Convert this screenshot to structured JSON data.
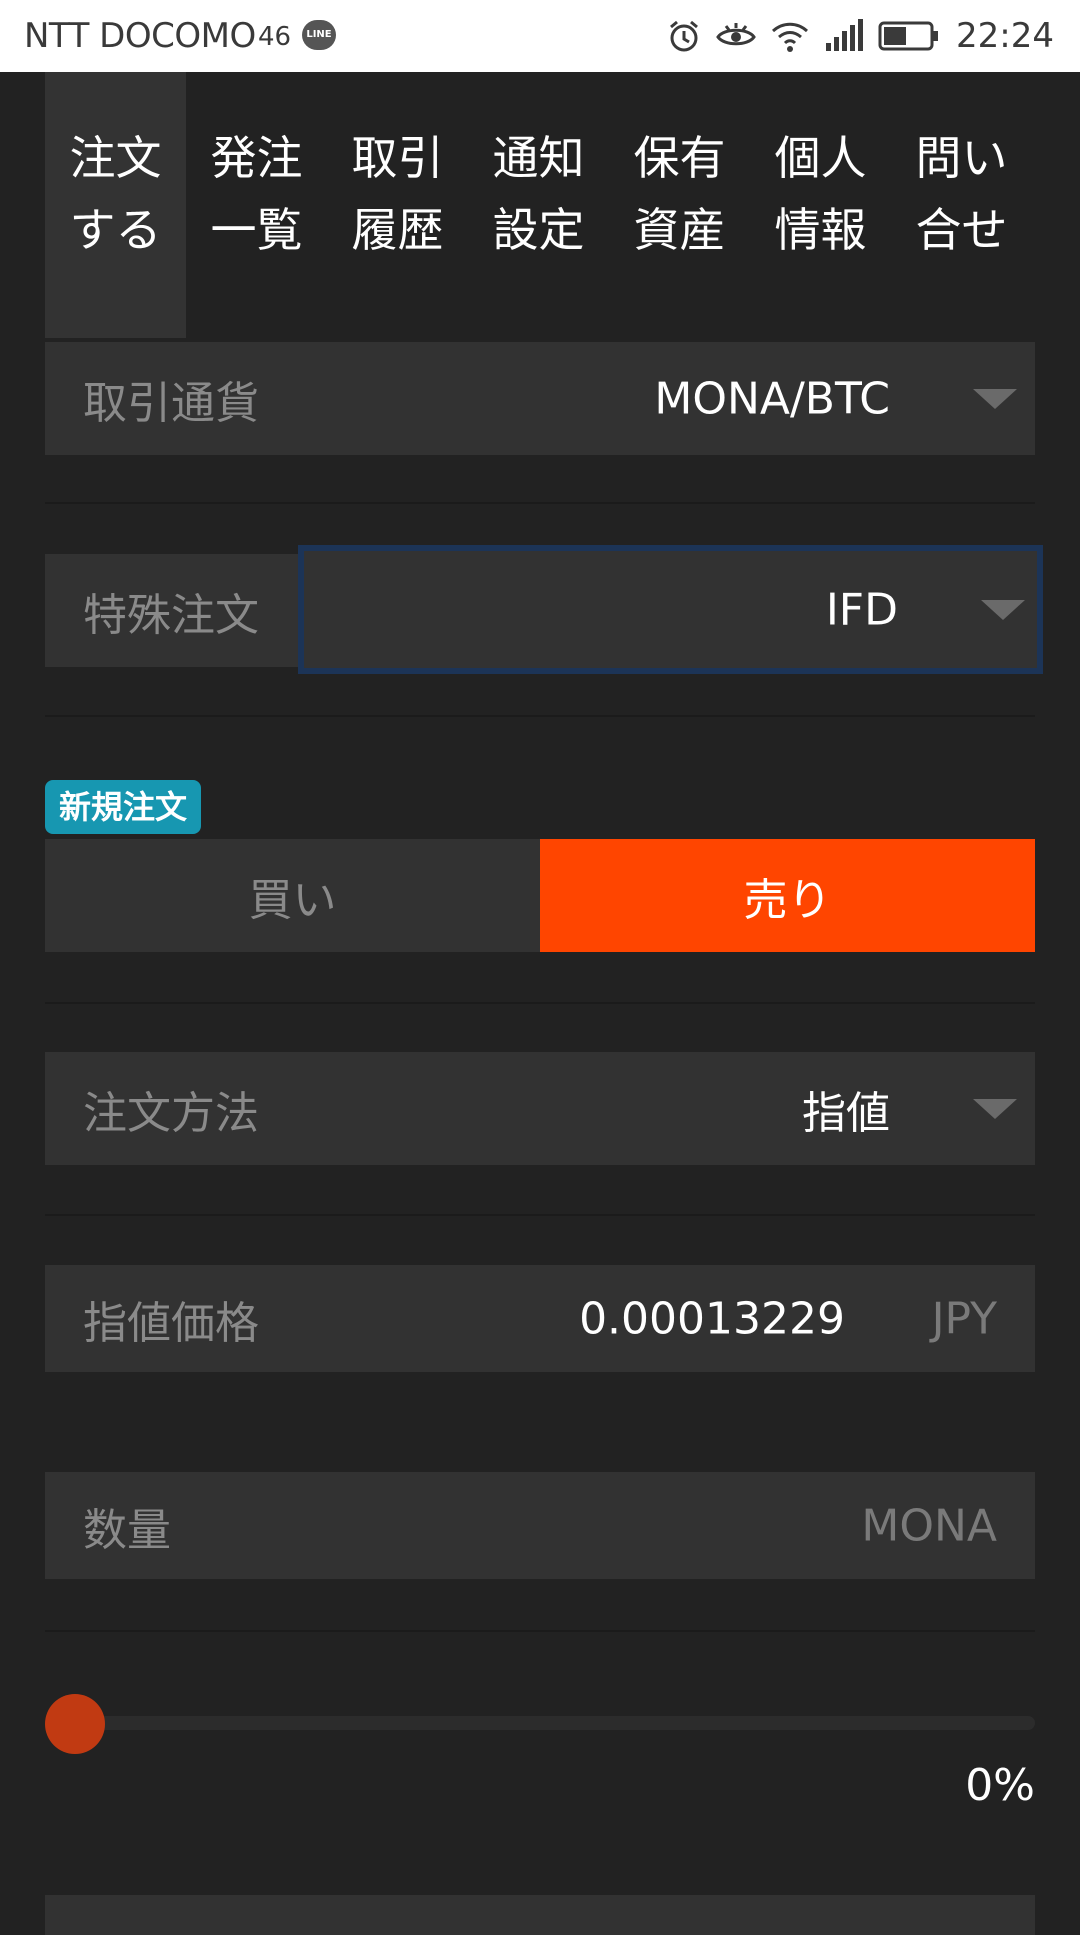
{
  "status_bar": {
    "carrier": "NTT DOCOMO",
    "network": "46",
    "line_icon": "LINE",
    "icons": [
      "alarm-icon",
      "eye-icon",
      "wifi-icon",
      "signal-icon",
      "battery-icon"
    ],
    "time": "22:24"
  },
  "tabs": [
    {
      "label": "注文\nする",
      "active": true
    },
    {
      "label": "発注\n一覧",
      "active": false
    },
    {
      "label": "取引\n履歴",
      "active": false
    },
    {
      "label": "通知\n設定",
      "active": false
    },
    {
      "label": "保有\n資産",
      "active": false
    },
    {
      "label": "個人\n情報",
      "active": false
    },
    {
      "label": "問い\n合せ",
      "active": false
    }
  ],
  "form": {
    "pair": {
      "label": "取引通貨",
      "value": "MONA/BTC"
    },
    "special_order": {
      "label": "特殊注文",
      "value": "IFD"
    },
    "new_order_badge": "新規注文",
    "side": {
      "buy": "買い",
      "sell": "売り",
      "selected": "sell"
    },
    "order_method": {
      "label": "注文方法",
      "value": "指値"
    },
    "limit_price": {
      "label": "指値価格",
      "value": "0.00013229",
      "unit": "JPY"
    },
    "quantity": {
      "label": "数量",
      "value": "",
      "unit": "MONA"
    },
    "slider": {
      "percent_label": "0%",
      "value": 0
    }
  },
  "colors": {
    "background": "#222222",
    "field": "#323232",
    "sell_active": "#ff4500",
    "badge": "#1797b1",
    "slider_thumb": "#c13a12",
    "focus_border": "#1c3457"
  }
}
